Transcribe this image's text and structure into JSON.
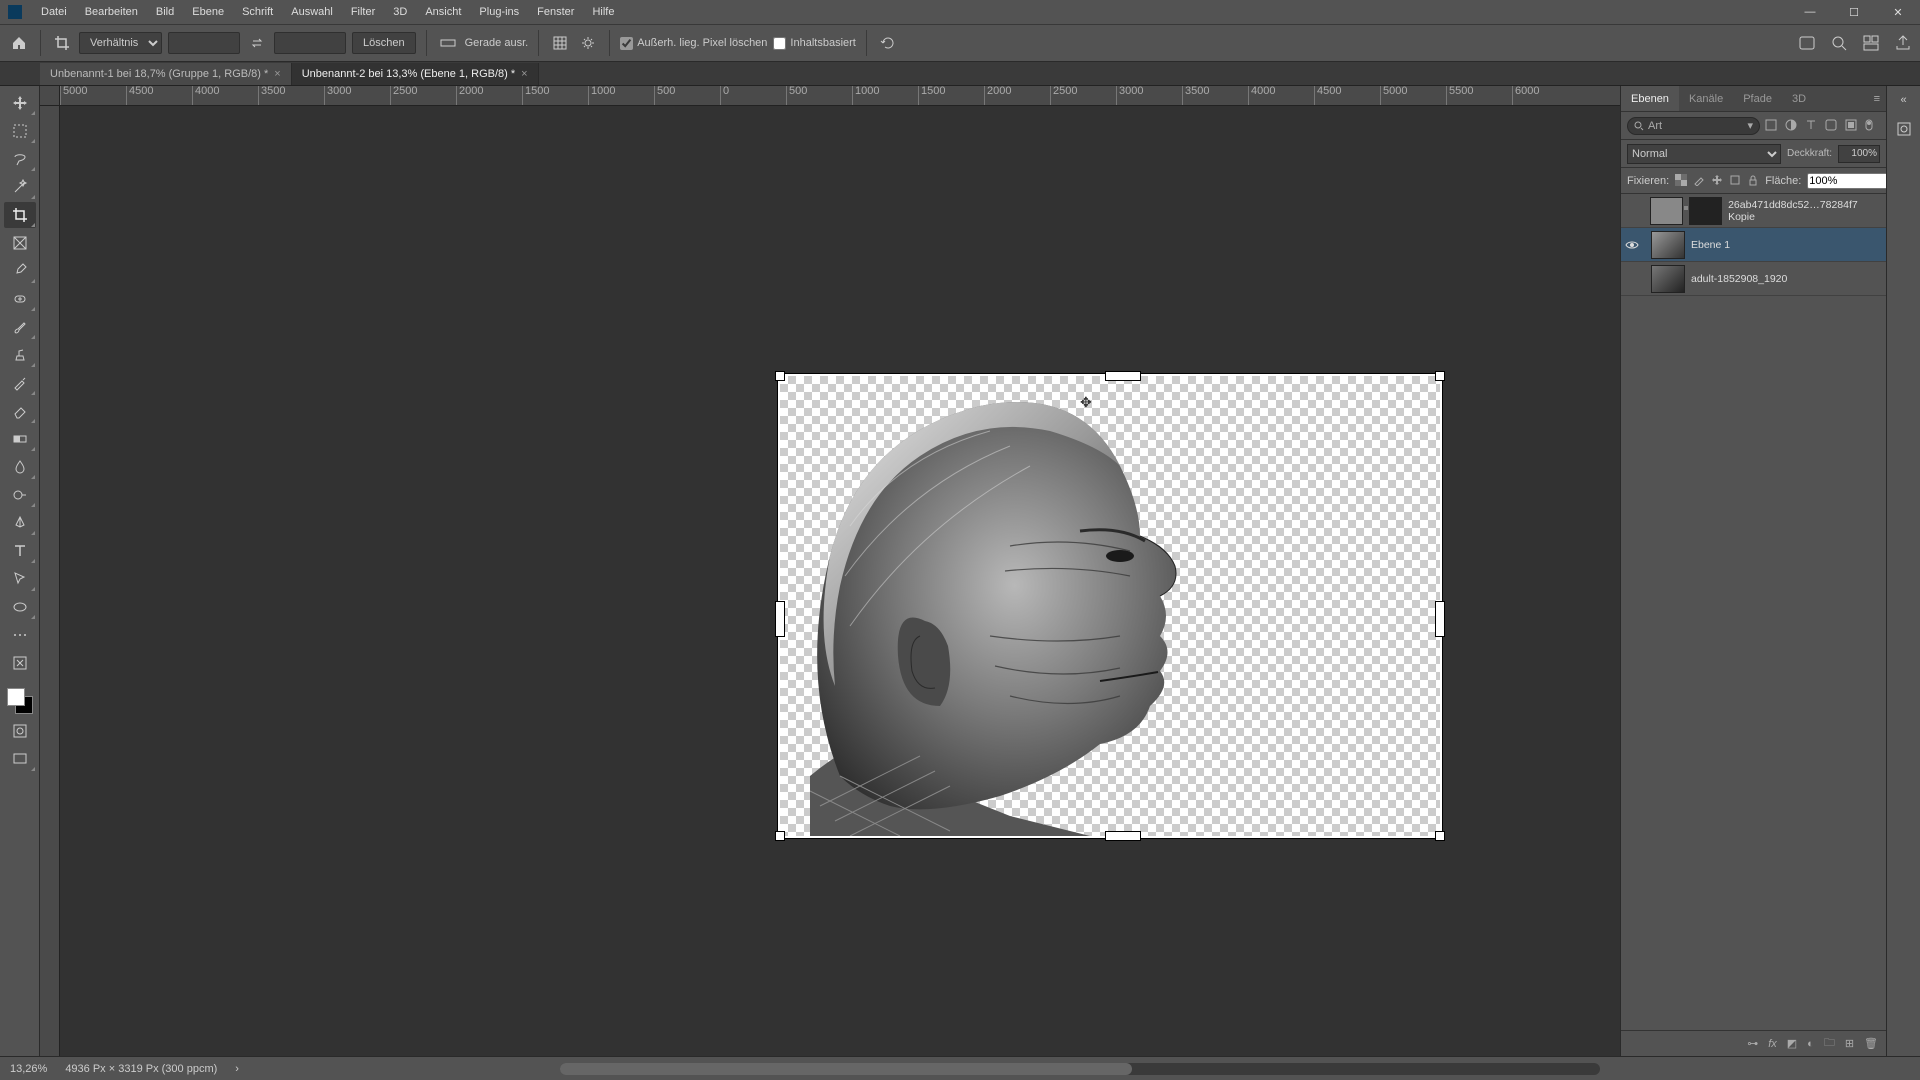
{
  "menu": {
    "items": [
      "Datei",
      "Bearbeiten",
      "Bild",
      "Ebene",
      "Schrift",
      "Auswahl",
      "Filter",
      "3D",
      "Ansicht",
      "Plug-ins",
      "Fenster",
      "Hilfe"
    ]
  },
  "win": {
    "min": "—",
    "max": "☐",
    "close": "✕"
  },
  "opt": {
    "ratio_label": "Verhältnis",
    "clear": "Löschen",
    "straighten": "Gerade ausr.",
    "delete_cropped": "Außerh. lieg. Pixel löschen",
    "content_aware": "Inhaltsbasiert"
  },
  "tabs": [
    {
      "label": "Unbenannt-1 bei 18,7% (Gruppe 1, RGB/8) *",
      "active": false
    },
    {
      "label": "Unbenannt-2 bei 13,3% (Ebene 1, RGB/8) *",
      "active": true
    }
  ],
  "ruler_h": [
    "5000",
    "4500",
    "4000",
    "3500",
    "3000",
    "2500",
    "2000",
    "1500",
    "1000",
    "500",
    "0",
    "500",
    "1000",
    "1500",
    "2000",
    "2500",
    "3000",
    "3500",
    "4000",
    "4500",
    "5000",
    "5500",
    "6000"
  ],
  "panel_tabs": {
    "layers": "Ebenen",
    "channels": "Kanäle",
    "paths": "Pfade",
    "threeD": "3D"
  },
  "filter": {
    "placeholder": "Art"
  },
  "blend": {
    "mode": "Normal",
    "opacity_label": "Deckkraft:",
    "opacity": "100%",
    "fill_label": "Fläche:",
    "fill": "100%",
    "lock_label": "Fixieren:"
  },
  "layers": [
    {
      "name": "26ab471dd8dc52…78284f7 Kopie",
      "visible": false,
      "selected": false
    },
    {
      "name": "Ebene 1",
      "visible": true,
      "selected": true
    },
    {
      "name": "adult-1852908_1920",
      "visible": false,
      "selected": false
    }
  ],
  "status": {
    "zoom": "13,26%",
    "docinfo": "4936 Px × 3319 Px (300 ppcm)",
    "chevron": "›"
  },
  "colors": {
    "accent": "#3a566e"
  }
}
